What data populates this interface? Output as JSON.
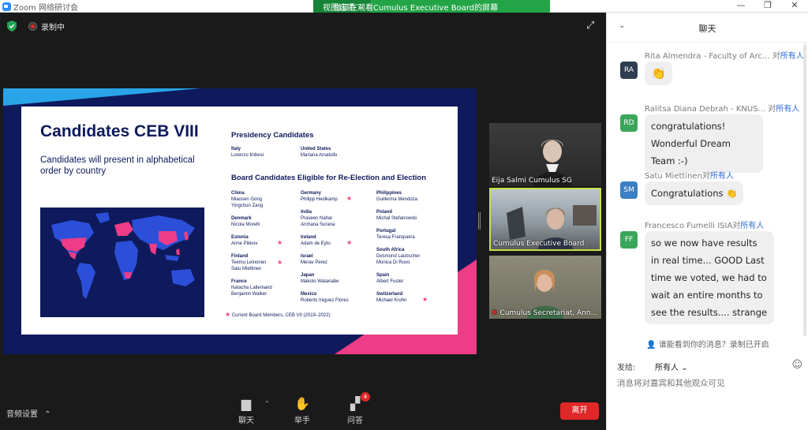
{
  "window": {
    "app_title": "Zoom 网络研讨会",
    "share_banner": "你正在观看Cumulus Executive Board的屏幕",
    "view_options": "视图选项",
    "controls": [
      "—",
      "❐",
      "✕"
    ]
  },
  "meeting": {
    "recording_label": "录制中"
  },
  "slide": {
    "title": "Candidates CEB VIII",
    "subtitle": "Candidates will present in alphabetical order by country",
    "presidency_heading": "Presidency Candidates",
    "presidency": [
      {
        "country": "Italy",
        "names": [
          "Lorenzo Imbesi"
        ]
      },
      {
        "country": "United States",
        "names": [
          "Mariana Amatullo"
        ]
      }
    ],
    "board_heading": "Board Candidates Eligible for Re-Election and Election",
    "board_col1": [
      {
        "country": "China",
        "names": [
          "Miaosen Gong",
          "Yingchun Zang"
        ]
      },
      {
        "country": "Denmark",
        "names": [
          "Nicola Morelli"
        ]
      },
      {
        "country": "Estonia",
        "names": [
          "Anne Pikkov"
        ],
        "star": true
      },
      {
        "country": "Finland",
        "names": [
          "Teemu Leinonen",
          "Satu Miettinen"
        ],
        "star": true
      },
      {
        "country": "France",
        "names": [
          "Natacha Lallemand",
          "Benjamin Walker"
        ]
      }
    ],
    "board_col2": [
      {
        "country": "Germany",
        "names": [
          "Philipp Heidkamp"
        ],
        "star": true
      },
      {
        "country": "India",
        "names": [
          "Praveen Nahar",
          "Archana Surana"
        ]
      },
      {
        "country": "Ireland",
        "names": [
          "Adam de Eyto"
        ],
        "star": true
      },
      {
        "country": "Israel",
        "names": [
          "Merav Perez"
        ]
      },
      {
        "country": "Japan",
        "names": [
          "Makoto Watanabe"
        ]
      },
      {
        "country": "Mexico",
        "names": [
          "Roberto Iniguez Flores"
        ]
      }
    ],
    "board_col3": [
      {
        "country": "Philippines",
        "names": [
          "Guillerma Mendoza"
        ]
      },
      {
        "country": "Poland",
        "names": [
          "Michal Stefanowski"
        ]
      },
      {
        "country": "Portugal",
        "names": [
          "Teresa Franqueira"
        ]
      },
      {
        "country": "South Africa",
        "names": [
          "Desmond Laubscher",
          "Monica Di Ruvo"
        ]
      },
      {
        "country": "Spain",
        "names": [
          "Albert Fuster"
        ]
      },
      {
        "country": "Switzerland",
        "names": [
          "Michael Krohn"
        ],
        "star": true
      }
    ],
    "footnote": "Current Board Members, CEB VII (2019–2022)",
    "colors": {
      "navy": "#0e1a5c",
      "pink": "#ef3c86",
      "blue": "#29a4e8"
    }
  },
  "videos": [
    {
      "name": "Eija Salmi Cumulus SG"
    },
    {
      "name": "Cumulus Executive Board"
    },
    {
      "name": "Cumulus Secretariat, Ann..."
    }
  ],
  "toolbar": {
    "audio_settings": "音频设置",
    "chat": "聊天",
    "raise_hand": "举手",
    "qa": "问答",
    "qa_badge": "4",
    "leave": "离开"
  },
  "chat": {
    "title": "聊天",
    "messages": [
      {
        "initials": "RA",
        "sender": "Rita Almendra - Faculty of Arc...",
        "to": "对",
        "recipient": "所有人",
        "text": "👏",
        "avatar_color": "#2f3d52"
      },
      {
        "initials": "RD",
        "sender": "Ralitsa Diana  Debrah - KNUS...",
        "to": "对",
        "recipient": "所有人",
        "text": "congratulations! Wonderful Dream Team :-)",
        "avatar_color": "#3aa65a"
      },
      {
        "initials": "SM",
        "sender": "Satu Miettinen",
        "to": "对",
        "recipient": "所有人",
        "text": "Congratulations 👏",
        "avatar_color": "#3b7fc4"
      },
      {
        "initials": "FF",
        "sender": "Francesco Fumelli ISIA",
        "to": "对",
        "recipient": "所有人",
        "text": "so we now have results in real time... GOOD Last time we voted, we had to wait an entire months to see the results.... strange",
        "avatar_color": "#3aa65a"
      }
    ],
    "visibility_note": "谁能看到你的消息？录制已开启",
    "send_to_label": "发给:",
    "send_to_value": "所有人",
    "input_placeholder": "消息将对嘉宾和其他观众可见"
  }
}
